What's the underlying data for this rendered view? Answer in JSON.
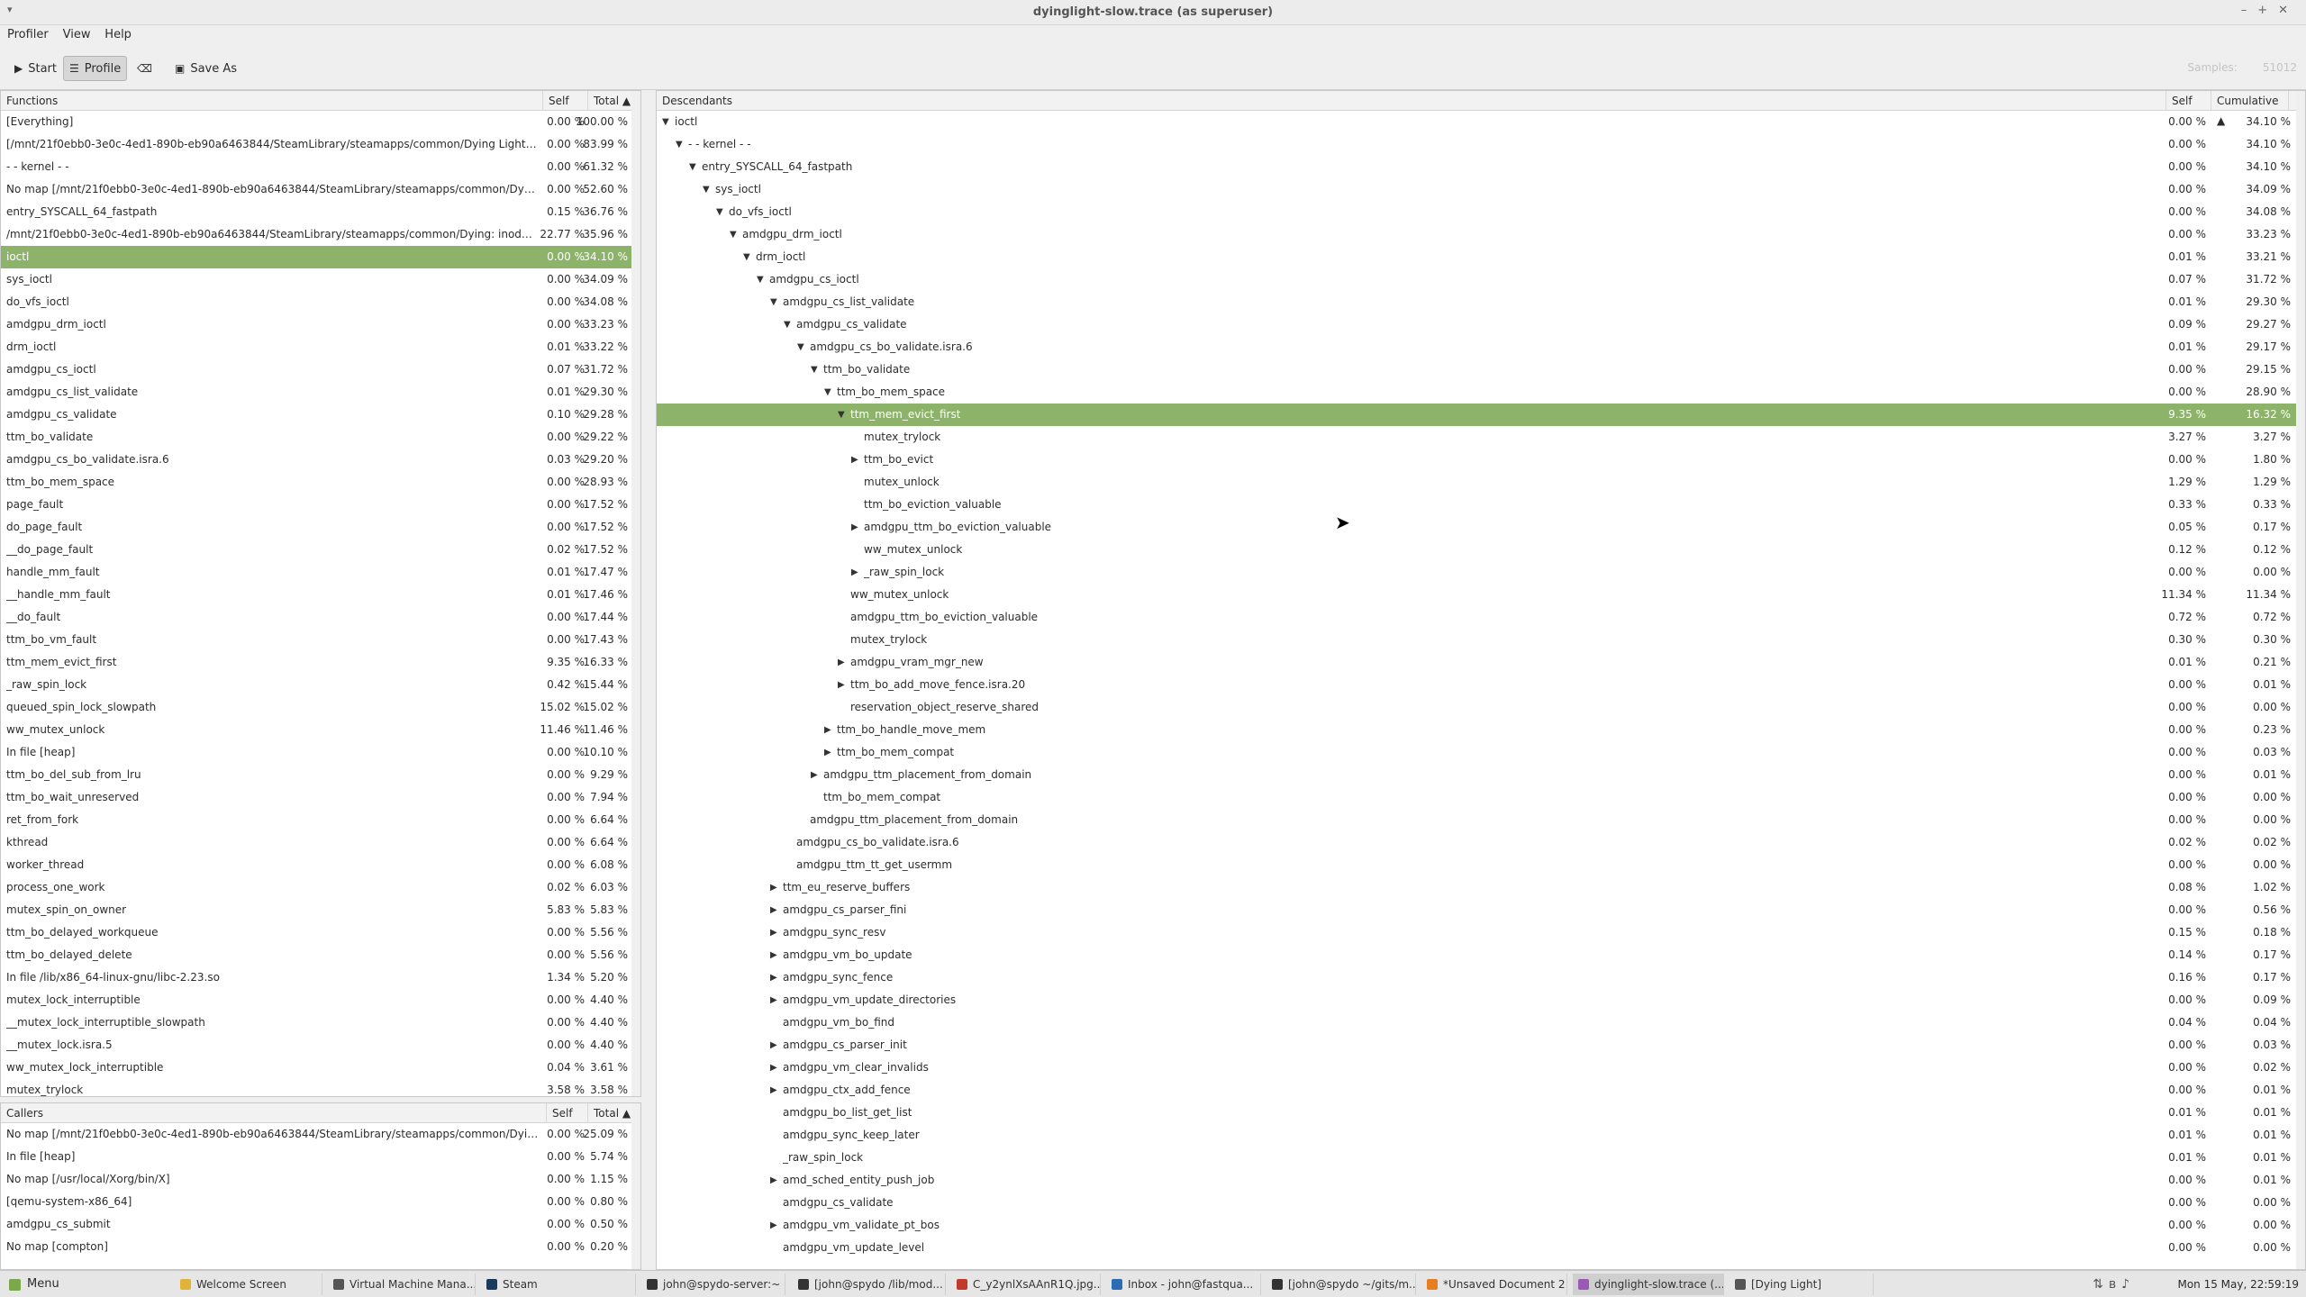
{
  "window": {
    "title": "dyinglight-slow.trace (as superuser)"
  },
  "menu": [
    "Profiler",
    "View",
    "Help"
  ],
  "toolbar": {
    "start": "Start",
    "profile": "Profile",
    "save_as": "Save As",
    "samples_label": "Samples:",
    "samples_value": "51012"
  },
  "functions": {
    "headers": {
      "name": "Functions",
      "self": "Self",
      "total": "Total ▲"
    },
    "rows": [
      [
        "[Everything]",
        "0.00 %",
        "100.00 %"
      ],
      [
        "[/mnt/21f0ebb0-3e0c-4ed1-890b-eb90a6463844/SteamLibrary/steamapps/common/Dying Light/DyingLi...",
        "0.00 %",
        "83.99 %"
      ],
      [
        "- - kernel - -",
        "0.00 %",
        "61.32 %"
      ],
      [
        "No map [/mnt/21f0ebb0-3e0c-4ed1-890b-eb90a6463844/SteamLibrary/steamapps/common/Dying Light...",
        "0.00 %",
        "52.60 %"
      ],
      [
        "entry_SYSCALL_64_fastpath",
        "0.15 %",
        "36.76 %"
      ],
      [
        "/mnt/21f0ebb0-3e0c-4ed1-890b-eb90a6463844/SteamLibrary/steamapps/common/Dying: inode misma...",
        "22.77 %",
        "35.96 %"
      ],
      [
        "ioctl",
        "0.00 %",
        "34.10 %"
      ],
      [
        "sys_ioctl",
        "0.00 %",
        "34.09 %"
      ],
      [
        "do_vfs_ioctl",
        "0.00 %",
        "34.08 %"
      ],
      [
        "amdgpu_drm_ioctl",
        "0.00 %",
        "33.23 %"
      ],
      [
        "drm_ioctl",
        "0.01 %",
        "33.22 %"
      ],
      [
        "amdgpu_cs_ioctl",
        "0.07 %",
        "31.72 %"
      ],
      [
        "amdgpu_cs_list_validate",
        "0.01 %",
        "29.30 %"
      ],
      [
        "amdgpu_cs_validate",
        "0.10 %",
        "29.28 %"
      ],
      [
        "ttm_bo_validate",
        "0.00 %",
        "29.22 %"
      ],
      [
        "amdgpu_cs_bo_validate.isra.6",
        "0.03 %",
        "29.20 %"
      ],
      [
        "ttm_bo_mem_space",
        "0.00 %",
        "28.93 %"
      ],
      [
        "page_fault",
        "0.00 %",
        "17.52 %"
      ],
      [
        "do_page_fault",
        "0.00 %",
        "17.52 %"
      ],
      [
        "__do_page_fault",
        "0.02 %",
        "17.52 %"
      ],
      [
        "handle_mm_fault",
        "0.01 %",
        "17.47 %"
      ],
      [
        "__handle_mm_fault",
        "0.01 %",
        "17.46 %"
      ],
      [
        "__do_fault",
        "0.00 %",
        "17.44 %"
      ],
      [
        "ttm_bo_vm_fault",
        "0.00 %",
        "17.43 %"
      ],
      [
        "ttm_mem_evict_first",
        "9.35 %",
        "16.33 %"
      ],
      [
        "_raw_spin_lock",
        "0.42 %",
        "15.44 %"
      ],
      [
        "queued_spin_lock_slowpath",
        "15.02 %",
        "15.02 %"
      ],
      [
        "ww_mutex_unlock",
        "11.46 %",
        "11.46 %"
      ],
      [
        "In file [heap]",
        "0.00 %",
        "10.10 %"
      ],
      [
        "ttm_bo_del_sub_from_lru",
        "0.00 %",
        "9.29 %"
      ],
      [
        "ttm_bo_wait_unreserved",
        "0.00 %",
        "7.94 %"
      ],
      [
        "ret_from_fork",
        "0.00 %",
        "6.64 %"
      ],
      [
        "kthread",
        "0.00 %",
        "6.64 %"
      ],
      [
        "worker_thread",
        "0.00 %",
        "6.08 %"
      ],
      [
        "process_one_work",
        "0.02 %",
        "6.03 %"
      ],
      [
        "mutex_spin_on_owner",
        "5.83 %",
        "5.83 %"
      ],
      [
        "ttm_bo_delayed_workqueue",
        "0.00 %",
        "5.56 %"
      ],
      [
        "ttm_bo_delayed_delete",
        "0.00 %",
        "5.56 %"
      ],
      [
        "In file /lib/x86_64-linux-gnu/libc-2.23.so",
        "1.34 %",
        "5.20 %"
      ],
      [
        "mutex_lock_interruptible",
        "0.00 %",
        "4.40 %"
      ],
      [
        "__mutex_lock_interruptible_slowpath",
        "0.00 %",
        "4.40 %"
      ],
      [
        "__mutex_lock.isra.5",
        "0.00 %",
        "4.40 %"
      ],
      [
        "ww_mutex_lock_interruptible",
        "0.04 %",
        "3.61 %"
      ],
      [
        "mutex_trylock",
        "3.58 %",
        "3.58 %"
      ]
    ]
  },
  "callers": {
    "headers": {
      "name": "Callers",
      "self": "Self",
      "total": "Total ▲"
    },
    "rows": [
      [
        "No map [/mnt/21f0ebb0-3e0c-4ed1-890b-eb90a6463844/SteamLibrary/steamapps/common/Dying Light/...",
        "0.00 %",
        "25.09 %"
      ],
      [
        "In file [heap]",
        "0.00 %",
        "5.74 %"
      ],
      [
        "No map [/usr/local/Xorg/bin/X]",
        "0.00 %",
        "1.15 %"
      ],
      [
        "[qemu-system-x86_64]",
        "0.00 %",
        "0.80 %"
      ],
      [
        "amdgpu_cs_submit",
        "0.00 %",
        "0.50 %"
      ],
      [
        "No map [compton]",
        "0.00 %",
        "0.20 %"
      ]
    ]
  },
  "descendants": {
    "headers": {
      "name": "Descendants",
      "self": "Self",
      "total": "Cumulative ▲"
    },
    "rows": [
      [
        0,
        "e",
        "ioctl",
        "0.00 %",
        "34.10 %"
      ],
      [
        1,
        "e",
        "- - kernel - -",
        "0.00 %",
        "34.10 %"
      ],
      [
        2,
        "e",
        "entry_SYSCALL_64_fastpath",
        "0.00 %",
        "34.10 %"
      ],
      [
        3,
        "e",
        "sys_ioctl",
        "0.00 %",
        "34.09 %"
      ],
      [
        4,
        "e",
        "do_vfs_ioctl",
        "0.00 %",
        "34.08 %"
      ],
      [
        5,
        "e",
        "amdgpu_drm_ioctl",
        "0.00 %",
        "33.23 %"
      ],
      [
        6,
        "e",
        "drm_ioctl",
        "0.01 %",
        "33.21 %"
      ],
      [
        7,
        "e",
        "amdgpu_cs_ioctl",
        "0.07 %",
        "31.72 %"
      ],
      [
        8,
        "e",
        "amdgpu_cs_list_validate",
        "0.01 %",
        "29.30 %"
      ],
      [
        9,
        "e",
        "amdgpu_cs_validate",
        "0.09 %",
        "29.27 %"
      ],
      [
        10,
        "e",
        "amdgpu_cs_bo_validate.isra.6",
        "0.01 %",
        "29.17 %"
      ],
      [
        11,
        "e",
        "ttm_bo_validate",
        "0.00 %",
        "29.15 %"
      ],
      [
        12,
        "e",
        "ttm_bo_mem_space",
        "0.00 %",
        "28.90 %"
      ],
      [
        13,
        "e",
        "ttm_mem_evict_first",
        "9.35 %",
        "16.32 %"
      ],
      [
        14,
        "",
        "mutex_trylock",
        "3.27 %",
        "3.27 %"
      ],
      [
        14,
        "c",
        "ttm_bo_evict",
        "0.00 %",
        "1.80 %"
      ],
      [
        14,
        "",
        "mutex_unlock",
        "1.29 %",
        "1.29 %"
      ],
      [
        14,
        "",
        "ttm_bo_eviction_valuable",
        "0.33 %",
        "0.33 %"
      ],
      [
        14,
        "c",
        "amdgpu_ttm_bo_eviction_valuable",
        "0.05 %",
        "0.17 %"
      ],
      [
        14,
        "",
        "ww_mutex_unlock",
        "0.12 %",
        "0.12 %"
      ],
      [
        14,
        "c",
        "_raw_spin_lock",
        "0.00 %",
        "0.00 %"
      ],
      [
        13,
        "",
        "ww_mutex_unlock",
        "11.34 %",
        "11.34 %"
      ],
      [
        13,
        "",
        "amdgpu_ttm_bo_eviction_valuable",
        "0.72 %",
        "0.72 %"
      ],
      [
        13,
        "",
        "mutex_trylock",
        "0.30 %",
        "0.30 %"
      ],
      [
        13,
        "c",
        "amdgpu_vram_mgr_new",
        "0.01 %",
        "0.21 %"
      ],
      [
        13,
        "c",
        "ttm_bo_add_move_fence.isra.20",
        "0.00 %",
        "0.01 %"
      ],
      [
        13,
        "",
        "reservation_object_reserve_shared",
        "0.00 %",
        "0.00 %"
      ],
      [
        12,
        "c",
        "ttm_bo_handle_move_mem",
        "0.00 %",
        "0.23 %"
      ],
      [
        12,
        "c",
        "ttm_bo_mem_compat",
        "0.00 %",
        "0.03 %"
      ],
      [
        11,
        "c",
        "amdgpu_ttm_placement_from_domain",
        "0.00 %",
        "0.01 %"
      ],
      [
        11,
        "",
        "ttm_bo_mem_compat",
        "0.00 %",
        "0.00 %"
      ],
      [
        10,
        "",
        "amdgpu_ttm_placement_from_domain",
        "0.00 %",
        "0.00 %"
      ],
      [
        9,
        "",
        "amdgpu_cs_bo_validate.isra.6",
        "0.02 %",
        "0.02 %"
      ],
      [
        9,
        "",
        "amdgpu_ttm_tt_get_usermm",
        "0.00 %",
        "0.00 %"
      ],
      [
        8,
        "c",
        "ttm_eu_reserve_buffers",
        "0.08 %",
        "1.02 %"
      ],
      [
        8,
        "c",
        "amdgpu_cs_parser_fini",
        "0.00 %",
        "0.56 %"
      ],
      [
        8,
        "c",
        "amdgpu_sync_resv",
        "0.15 %",
        "0.18 %"
      ],
      [
        8,
        "c",
        "amdgpu_vm_bo_update",
        "0.14 %",
        "0.17 %"
      ],
      [
        8,
        "c",
        "amdgpu_sync_fence",
        "0.16 %",
        "0.17 %"
      ],
      [
        8,
        "c",
        "amdgpu_vm_update_directories",
        "0.00 %",
        "0.09 %"
      ],
      [
        8,
        "",
        "amdgpu_vm_bo_find",
        "0.04 %",
        "0.04 %"
      ],
      [
        8,
        "c",
        "amdgpu_cs_parser_init",
        "0.00 %",
        "0.03 %"
      ],
      [
        8,
        "c",
        "amdgpu_vm_clear_invalids",
        "0.00 %",
        "0.02 %"
      ],
      [
        8,
        "c",
        "amdgpu_ctx_add_fence",
        "0.00 %",
        "0.01 %"
      ],
      [
        8,
        "",
        "amdgpu_bo_list_get_list",
        "0.01 %",
        "0.01 %"
      ],
      [
        8,
        "",
        "amdgpu_sync_keep_later",
        "0.01 %",
        "0.01 %"
      ],
      [
        8,
        "",
        "_raw_spin_lock",
        "0.01 %",
        "0.01 %"
      ],
      [
        8,
        "c",
        "amd_sched_entity_push_job",
        "0.00 %",
        "0.01 %"
      ],
      [
        8,
        "",
        "amdgpu_cs_validate",
        "0.00 %",
        "0.00 %"
      ],
      [
        8,
        "c",
        "amdgpu_vm_validate_pt_bos",
        "0.00 %",
        "0.00 %"
      ],
      [
        8,
        "",
        "amdgpu_vm_update_level",
        "0.00 %",
        "0.00 %"
      ]
    ]
  },
  "taskbar": {
    "menu": "Menu",
    "tasks": [
      "Welcome Screen",
      "Virtual Machine Mana...",
      "Steam",
      "john@spydo-server:~",
      "[john@spydo /lib/mod...",
      "C_y2ynlXsAAnR1Q.jpg...",
      "Inbox - john@fastqua...",
      "[john@spydo ~/gits/m...",
      "*Unsaved Document 2",
      "dyinglight-slow.trace (...",
      "[Dying Light]"
    ],
    "clock": "Mon 15 May, 22:59:19"
  }
}
